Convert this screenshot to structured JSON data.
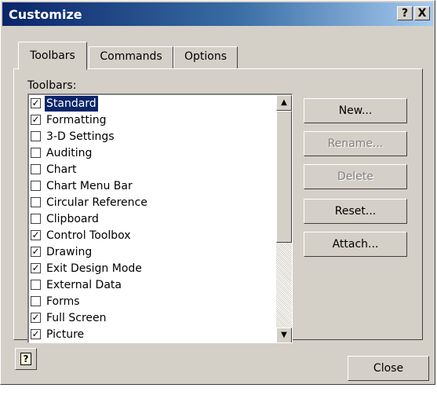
{
  "window": {
    "title": "Customize",
    "help_glyph": "?",
    "close_glyph": "X",
    "colors": {
      "titlebar": "#0a246a",
      "face": "#d4d0c8",
      "selection": "#0a246a"
    }
  },
  "tabs": [
    {
      "label": "Toolbars",
      "active": true
    },
    {
      "label": "Commands",
      "active": false
    },
    {
      "label": "Options",
      "active": false
    }
  ],
  "toolbars_label": "Toolbars:",
  "toolbars": [
    {
      "label": "Standard",
      "checked": true,
      "selected": true
    },
    {
      "label": "Formatting",
      "checked": true,
      "selected": false
    },
    {
      "label": "3-D Settings",
      "checked": false,
      "selected": false
    },
    {
      "label": "Auditing",
      "checked": false,
      "selected": false
    },
    {
      "label": "Chart",
      "checked": false,
      "selected": false
    },
    {
      "label": "Chart Menu Bar",
      "checked": false,
      "selected": false
    },
    {
      "label": "Circular Reference",
      "checked": false,
      "selected": false
    },
    {
      "label": "Clipboard",
      "checked": false,
      "selected": false
    },
    {
      "label": "Control Toolbox",
      "checked": true,
      "selected": false
    },
    {
      "label": "Drawing",
      "checked": true,
      "selected": false
    },
    {
      "label": "Exit Design Mode",
      "checked": true,
      "selected": false
    },
    {
      "label": "External Data",
      "checked": false,
      "selected": false
    },
    {
      "label": "Forms",
      "checked": false,
      "selected": false
    },
    {
      "label": "Full Screen",
      "checked": true,
      "selected": false
    },
    {
      "label": "Picture",
      "checked": true,
      "selected": false
    }
  ],
  "scrollbar": {
    "up_glyph": "▲",
    "down_glyph": "▼",
    "scroll_position": 0
  },
  "buttons": {
    "new": "New...",
    "rename": "Rename...",
    "delete": "Delete",
    "reset": "Reset...",
    "attach": "Attach..."
  },
  "help_button": {
    "icon": "help-question-icon",
    "glyph": "?"
  },
  "close_button": "Close"
}
